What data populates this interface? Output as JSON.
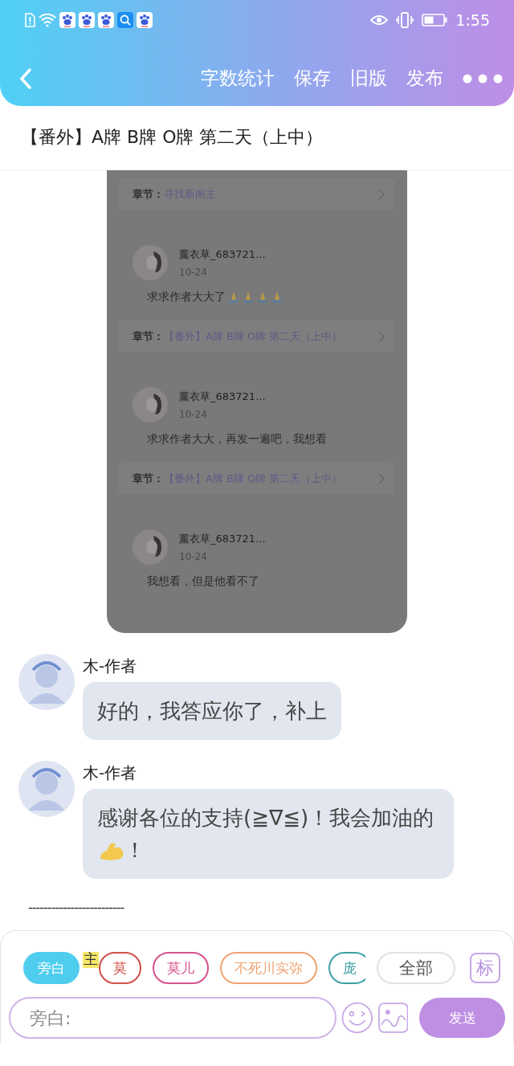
{
  "status_bar": {
    "time": "1:55"
  },
  "header": {
    "actions": [
      "字数统计",
      "保存",
      "旧版",
      "发布"
    ]
  },
  "title": "【番外】A牌 B牌 O牌 第二天（上中）",
  "shared_screenshot": {
    "top_chapter": {
      "label": "章节：",
      "title": "寻找新阁主"
    },
    "comments": [
      {
        "user": "薰衣草_683721...",
        "date": "10-24",
        "text": "求求作者大大了",
        "emoji": true,
        "chapter": {
          "label": "章节：",
          "title": "【番外】A牌 B牌 O牌 第二天（上中）"
        }
      },
      {
        "user": "薰衣草_683721...",
        "date": "10-24",
        "text": "求求作者大大，再发一遍吧，我想看",
        "emoji": false,
        "chapter": {
          "label": "章节：",
          "title": "【番外】A牌 B牌 O牌 第二天（上中）"
        }
      },
      {
        "user": "薰衣草_683721...",
        "date": "10-24",
        "text": "我想看，但是他看不了",
        "emoji": false
      }
    ]
  },
  "messages": [
    {
      "author": "木-作者",
      "text": "好的，我答应你了，补上",
      "emoji": false
    },
    {
      "author": "木-作者",
      "text": "感谢各位的支持(≧∇≦)！我会加油的",
      "emoji": true,
      "tail": "！"
    }
  ],
  "divider_text": "-------------------------",
  "roles": [
    {
      "label": "旁白",
      "color": "#4fcdee",
      "selected": true
    },
    {
      "label": "莫",
      "color": "#d0504a",
      "selected": false,
      "badge": "主"
    },
    {
      "label": "莫儿",
      "color": "#d8508a",
      "selected": false
    },
    {
      "label": "不死川实弥",
      "color": "#eea373",
      "selected": false
    },
    {
      "label": "庞",
      "color": "#3f9fa6",
      "selected": false
    }
  ],
  "all_button": "全部",
  "mark_button": "标",
  "input": {
    "placeholder": "旁白:"
  },
  "send_button": "发送"
}
